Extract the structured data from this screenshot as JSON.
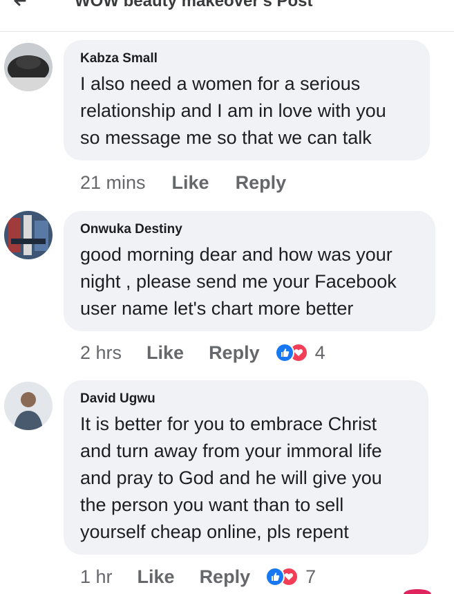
{
  "header": {
    "title": "WOW beauty makeover's Post"
  },
  "comments": [
    {
      "author": "Kabza Small",
      "text": "I also need a women for a serious\nrelationship and I am in love with you\nso message me so that we can talk",
      "time": "21 mins",
      "like_label": "Like",
      "reply_label": "Reply",
      "reaction_count": ""
    },
    {
      "author": "Onwuka Destiny",
      "text": "good morning dear and how was your\nnight , please send me your Facebook\nuser name let's chart more better",
      "time": "2 hrs",
      "like_label": "Like",
      "reply_label": "Reply",
      "reaction_count": "4"
    },
    {
      "author": "David Ugwu",
      "text": "It is better for you to embrace Christ\nand turn away from your immoral life\nand pray to God and he will give you\nthe person you want than to sell\nyourself cheap online, pls repent",
      "time": "1 hr",
      "like_label": "Like",
      "reply_label": "Reply",
      "reaction_count": "7"
    }
  ],
  "colors": {
    "like_blue": "#1877f2",
    "love_red": "#f33e58",
    "bubble_bg": "#f0f2f5",
    "meta_gray": "#65676b"
  },
  "icons": [
    "back-arrow-icon",
    "like-reaction-icon",
    "love-reaction-icon"
  ]
}
